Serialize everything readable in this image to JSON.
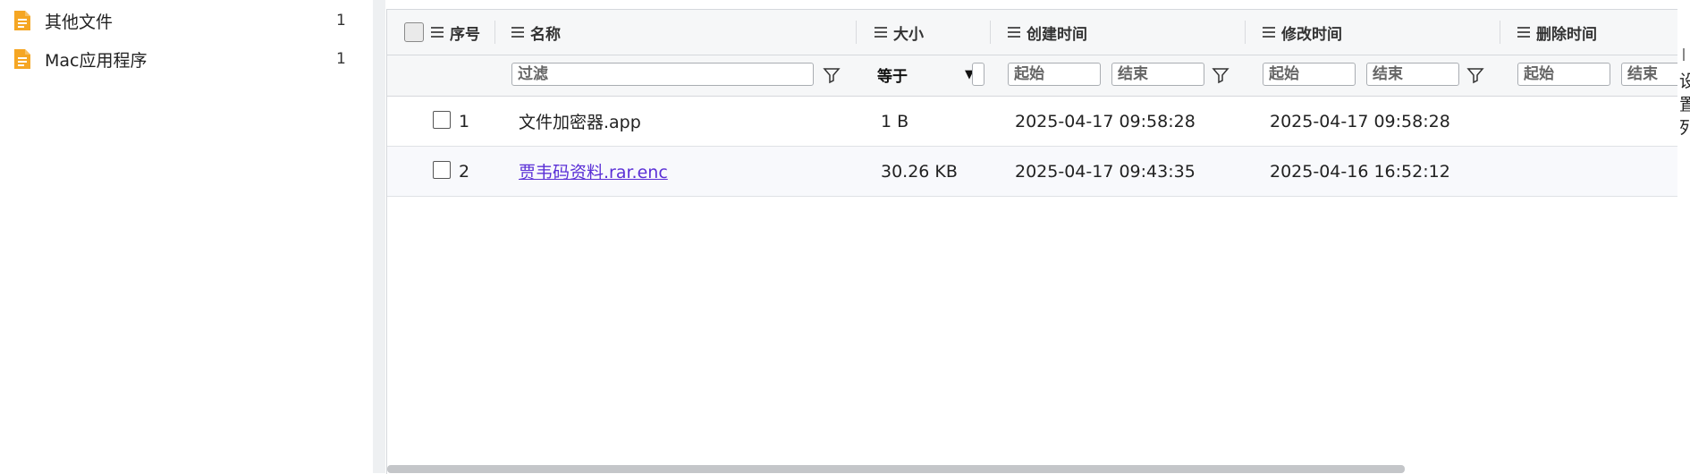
{
  "sidebar": {
    "items": [
      {
        "icon": "document-folder-icon",
        "label": "其他文件",
        "count": "1"
      },
      {
        "icon": "document-folder-icon",
        "label": "Mac应用程序",
        "count": "1"
      }
    ]
  },
  "table": {
    "columns": {
      "index": "序号",
      "name": "名称",
      "size": "大小",
      "created": "创建时间",
      "modified": "修改时间",
      "deleted": "删除时间"
    },
    "filters": {
      "name_placeholder": "过滤",
      "size_operator": "等于",
      "created_start": "起始",
      "created_end": "结束",
      "modified_start": "起始",
      "modified_end": "结束",
      "deleted_start": "起始",
      "deleted_end": "结束"
    },
    "rows": [
      {
        "index": "1",
        "name": "文件加密器.app",
        "size": "1 B",
        "created": "2025-04-17 09:58:28",
        "modified": "2025-04-17 09:58:28"
      },
      {
        "index": "2",
        "name": "贾韦码资料.rar.enc",
        "size": "30.26 KB",
        "created": "2025-04-17 09:43:35",
        "modified": "2025-04-16 16:52:12"
      }
    ]
  },
  "right_panel": {
    "chars": [
      "设",
      "置",
      "列"
    ]
  },
  "colors": {
    "folder_icon": "#f5a623",
    "link": "#5a2fd6"
  }
}
